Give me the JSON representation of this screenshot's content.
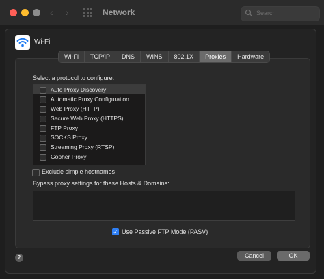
{
  "window": {
    "title": "Network",
    "search_placeholder": "Search"
  },
  "sheet": {
    "service_name": "Wi-Fi",
    "tabs": [
      "Wi-Fi",
      "TCP/IP",
      "DNS",
      "WINS",
      "802.1X",
      "Proxies",
      "Hardware"
    ],
    "active_tab": "Proxies",
    "protocol_label": "Select a protocol to configure:",
    "protocols": [
      {
        "label": "Auto Proxy Discovery",
        "checked": false,
        "selected": true
      },
      {
        "label": "Automatic Proxy Configuration",
        "checked": false,
        "selected": false
      },
      {
        "label": "Web Proxy (HTTP)",
        "checked": false,
        "selected": false
      },
      {
        "label": "Secure Web Proxy (HTTPS)",
        "checked": false,
        "selected": false
      },
      {
        "label": "FTP Proxy",
        "checked": false,
        "selected": false
      },
      {
        "label": "SOCKS Proxy",
        "checked": false,
        "selected": false
      },
      {
        "label": "Streaming Proxy (RTSP)",
        "checked": false,
        "selected": false
      },
      {
        "label": "Gopher Proxy",
        "checked": false,
        "selected": false
      }
    ],
    "exclude_simple_label": "Exclude simple hostnames",
    "exclude_simple_checked": false,
    "bypass_label": "Bypass proxy settings for these Hosts & Domains:",
    "bypass_value": "",
    "pasv_label": "Use Passive FTP Mode (PASV)",
    "pasv_checked": true,
    "help_label": "?",
    "cancel_label": "Cancel",
    "ok_label": "OK"
  }
}
